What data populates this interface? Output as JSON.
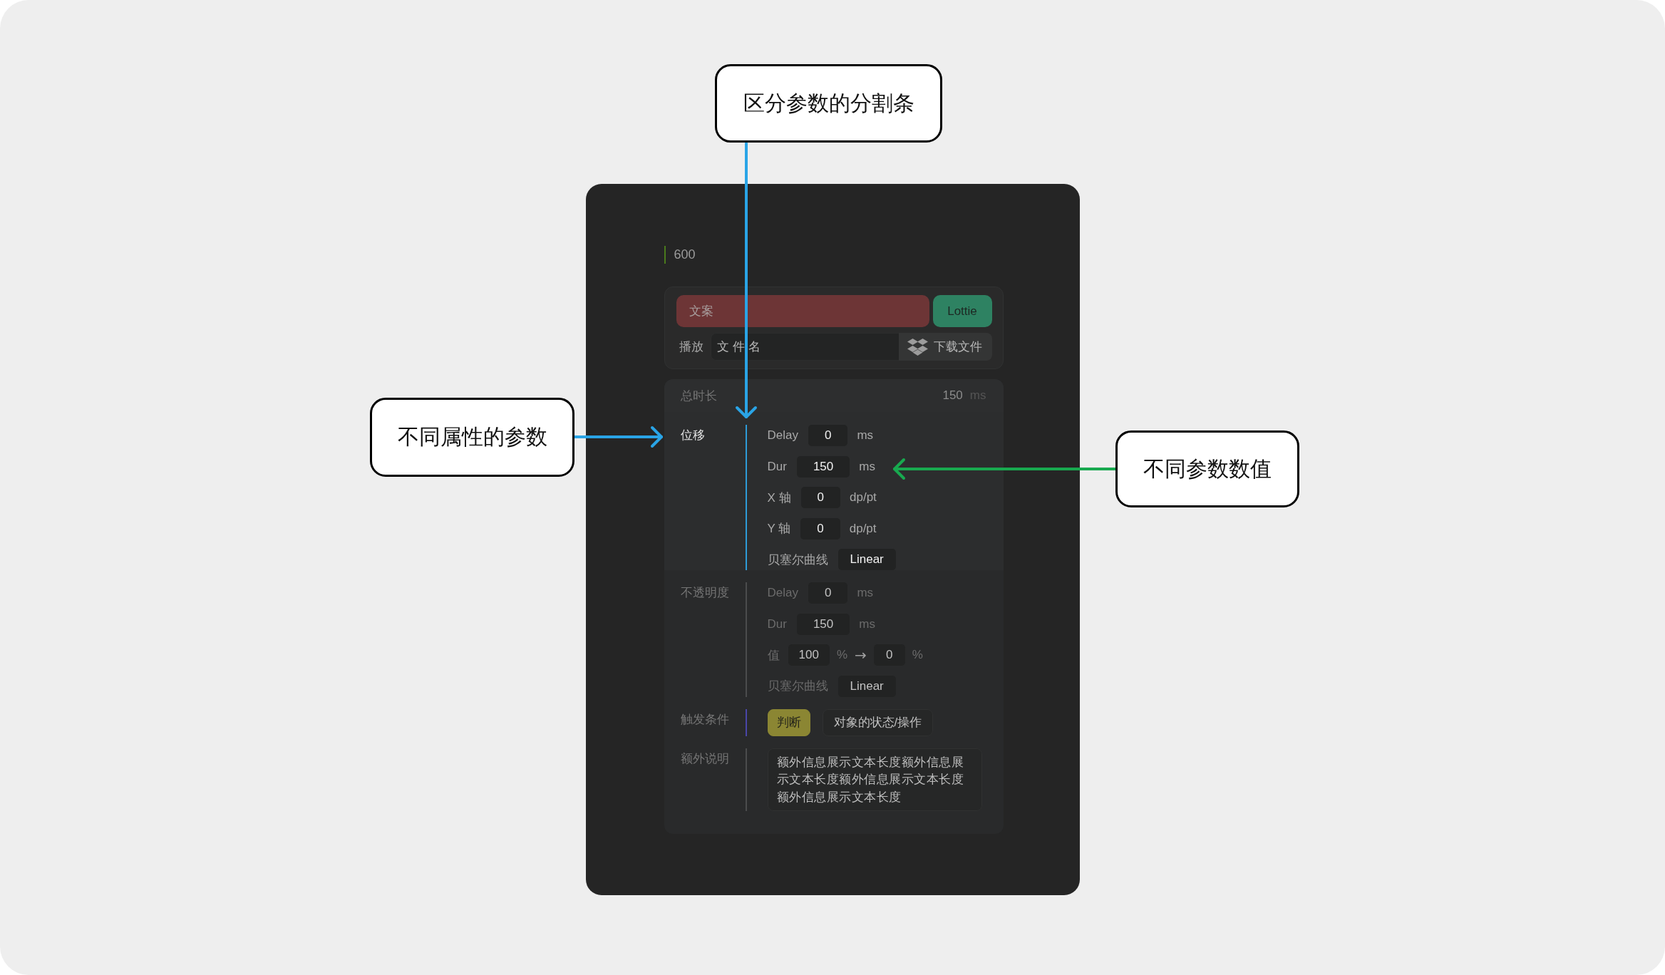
{
  "annotations": [
    {
      "text": "区分参数的分割条",
      "color": "#2aa4e6"
    },
    {
      "text": "不同属性的参数",
      "color": "#2aa4e6"
    },
    {
      "text": "不同参数数值",
      "color": "#18a94f"
    }
  ],
  "panel": {
    "heading": "600",
    "asset": {
      "label": "文案",
      "format_button": "Lottie",
      "play_label": "播放",
      "file_field": {
        "placeholder": "文件名"
      },
      "download_button": "下载文件"
    },
    "timeline": {
      "total": {
        "label": "总时长",
        "value": "150",
        "unit": "ms"
      },
      "groups": [
        {
          "kind": "params",
          "name": "位移",
          "selected": true,
          "color": "#2e9bd8",
          "params": [
            {
              "kind": "field",
              "label": "Delay",
              "value": "0",
              "unit": "ms"
            },
            {
              "kind": "field",
              "label": "Dur",
              "value": "150",
              "unit": "ms"
            },
            {
              "kind": "field",
              "label": "X 轴",
              "value": "0",
              "unit": "dp/pt"
            },
            {
              "kind": "field",
              "label": "Y 轴",
              "value": "0",
              "unit": "dp/pt"
            },
            {
              "kind": "select",
              "label": "贝塞尔曲线",
              "value": "Linear"
            }
          ]
        },
        {
          "kind": "params",
          "name": "不透明度",
          "selected": false,
          "color": "#4b4c4d",
          "params": [
            {
              "kind": "field",
              "label": "Delay",
              "value": "0",
              "unit": "ms"
            },
            {
              "kind": "field",
              "label": "Dur",
              "value": "150",
              "unit": "ms"
            },
            {
              "kind": "range",
              "label": "值",
              "from": "100",
              "from_unit": "%",
              "arrow": "→",
              "to": "0",
              "to_unit": "%"
            },
            {
              "kind": "select",
              "label": "贝塞尔曲线",
              "value": "Linear"
            }
          ]
        },
        {
          "kind": "choices",
          "name": "触发条件",
          "selected": false,
          "color": "#4a46a8",
          "options": [
            {
              "label": "判断",
              "selected": true
            },
            {
              "label": "对象的状态/操作",
              "selected": false
            }
          ]
        },
        {
          "kind": "note",
          "name": "额外说明",
          "selected": false,
          "color": "#4b4c4d",
          "value": "额外信息展示文本长度额外信息展示文本长度额外信息展示文本长度额外信息展示文本长度"
        }
      ]
    }
  }
}
